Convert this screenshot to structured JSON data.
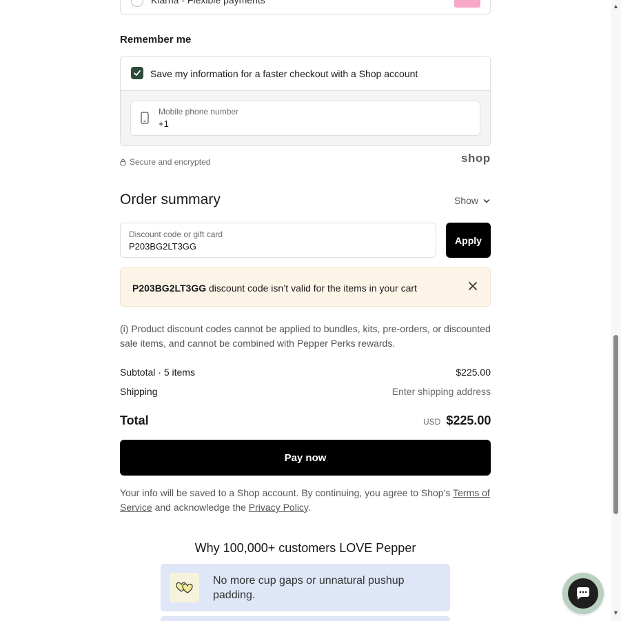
{
  "payment_option": {
    "label": "Klarna - Flexible payments"
  },
  "remember_me": {
    "title": "Remember me",
    "save_label": "Save my information for a faster checkout with a Shop account",
    "checked": true,
    "phone_label": "Mobile phone number",
    "phone_value": "+1"
  },
  "secure_text": "Secure and encrypted",
  "shop_logo": "shop",
  "order_summary": {
    "title": "Order summary",
    "toggle_label": "Show",
    "discount_label": "Discount code or gift card",
    "discount_value": "P203BG2LT3GG",
    "apply_label": "Apply",
    "error_code": "P203BG2LT3GG",
    "error_message": " discount code isn’t valid for the items in your cart",
    "note": "(i) Product discount codes cannot be applied to bundles, kits, pre-orders, or discounted sale items, and cannot be combined with Pepper Perks rewards.",
    "subtotal_label": "Subtotal · 5 items",
    "subtotal_value": "$225.00",
    "shipping_label": "Shipping",
    "shipping_value": "Enter shipping address",
    "total_label": "Total",
    "total_currency": "USD",
    "total_value": "$225.00",
    "pay_label": "Pay now"
  },
  "legal": {
    "prefix": "Your info will be saved to a Shop account. By continuing, you agree to Shop’s ",
    "terms": "Terms of Service",
    "middle": " and acknowledge the ",
    "privacy": "Privacy Policy",
    "suffix": "."
  },
  "why": {
    "title": "Why 100,000+ customers LOVE Pepper",
    "feature_1": "No more cup gaps or unnatural pushup padding."
  },
  "colors": {
    "checkbox": "#2f4a3a",
    "error_bg": "#fdf4e8",
    "button": "#000000",
    "feature_bg": "#dfe6f7",
    "chat_ring": "#b9cfc0"
  },
  "icons": [
    "phone-icon",
    "lock-icon",
    "chevron-down-icon",
    "close-icon",
    "hearts-icon",
    "chat-icon",
    "check-icon"
  ]
}
